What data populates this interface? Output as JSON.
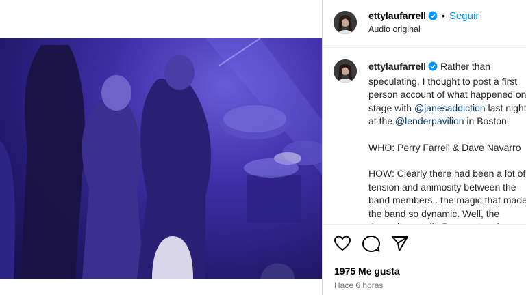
{
  "post": {
    "username": "ettylaufarrell",
    "follow_label": "Seguir",
    "separator": "•",
    "audio_label": "Audio original"
  },
  "caption": {
    "username": "ettylaufarrell",
    "line1": "Rather than speculating, I thought to post a first person account of what happened on stage with ",
    "mention1": "@janesaddiction",
    "line2": " last night at the ",
    "mention2": "@lenderpavilion",
    "line3": " in Boston.",
    "who": "WHO: Perry Farrell & Dave Navarro",
    "how": "HOW: Clearly there had been a lot of tension and animosity between the band members.. the magic that made the band so dynamic. Well, the dynamite was lit. Perry got up in Dave's face and"
  },
  "stats": {
    "likes": "1975 Me gusta",
    "time": "Hace 6 horas"
  },
  "icons": {
    "mute": "muted-speaker-icon",
    "like": "heart-icon",
    "comment": "comment-bubble-icon",
    "share": "paper-plane-icon",
    "verified": "verified-badge-icon"
  },
  "colors": {
    "accent": "#0095f6",
    "verified": "#0095f6",
    "mention": "#00376b",
    "muted_text": "#737373"
  }
}
